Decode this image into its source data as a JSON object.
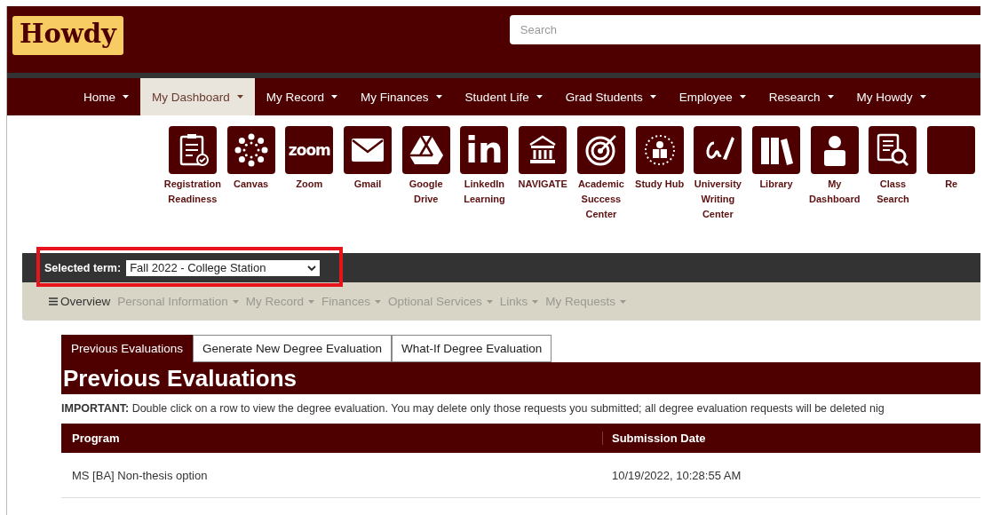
{
  "header": {
    "logo": "Howdy",
    "search": {
      "placeholder": "Search"
    }
  },
  "nav": [
    {
      "label": "Home",
      "selected": false
    },
    {
      "label": "My Dashboard",
      "selected": true
    },
    {
      "label": "My Record",
      "selected": false
    },
    {
      "label": "My Finances",
      "selected": false
    },
    {
      "label": "Student Life",
      "selected": false
    },
    {
      "label": "Grad Students",
      "selected": false
    },
    {
      "label": "Employee",
      "selected": false
    },
    {
      "label": "Research",
      "selected": false
    },
    {
      "label": "My Howdy",
      "selected": false
    }
  ],
  "apps": [
    {
      "kind": "clipboard",
      "label": "Registration Readiness"
    },
    {
      "kind": "canvas",
      "label": "Canvas"
    },
    {
      "kind": "wordmark",
      "glyph": "zoom",
      "label": "Zoom"
    },
    {
      "kind": "envelope",
      "label": "Gmail"
    },
    {
      "kind": "drive",
      "label": "Google Drive"
    },
    {
      "kind": "wordmark",
      "glyph": "in",
      "label": "LinkedIn Learning"
    },
    {
      "kind": "building",
      "label": "NAVIGATE"
    },
    {
      "kind": "target",
      "label": "Academic Success Center"
    },
    {
      "kind": "reader",
      "label": "Study Hub"
    },
    {
      "kind": "pen",
      "label": "University Writing Center"
    },
    {
      "kind": "books",
      "label": "Library"
    },
    {
      "kind": "person",
      "label": "My Dashboard"
    },
    {
      "kind": "search",
      "label": "Class Search"
    },
    {
      "kind": "blank",
      "label": "Re"
    }
  ],
  "term": {
    "label": "Selected term:",
    "value": "Fall 2022 - College Station",
    "highlighted": true
  },
  "subnav": {
    "overview": "Overview",
    "menus": [
      "Personal Information",
      "My Record",
      "Finances",
      "Optional Services",
      "Links",
      "My Requests"
    ]
  },
  "tabs": [
    {
      "label": "Previous Evaluations",
      "selected": true
    },
    {
      "label": "Generate New Degree Evaluation",
      "selected": false
    },
    {
      "label": "What-If Degree Evaluation",
      "selected": false
    }
  ],
  "section": {
    "title": "Previous Evaluations",
    "notice": "**IMPORTANT:** Double click on a row to view the degree evaluation. You may delete only those requests you submitted; all degree evaluation requests will be deleted nig"
  },
  "table": {
    "columns": [
      "Program",
      "Submission Date"
    ],
    "rows": [
      [
        "MS [BA] Non-thesis option",
        "10/19/2022, 10:28:55 AM"
      ]
    ]
  }
}
